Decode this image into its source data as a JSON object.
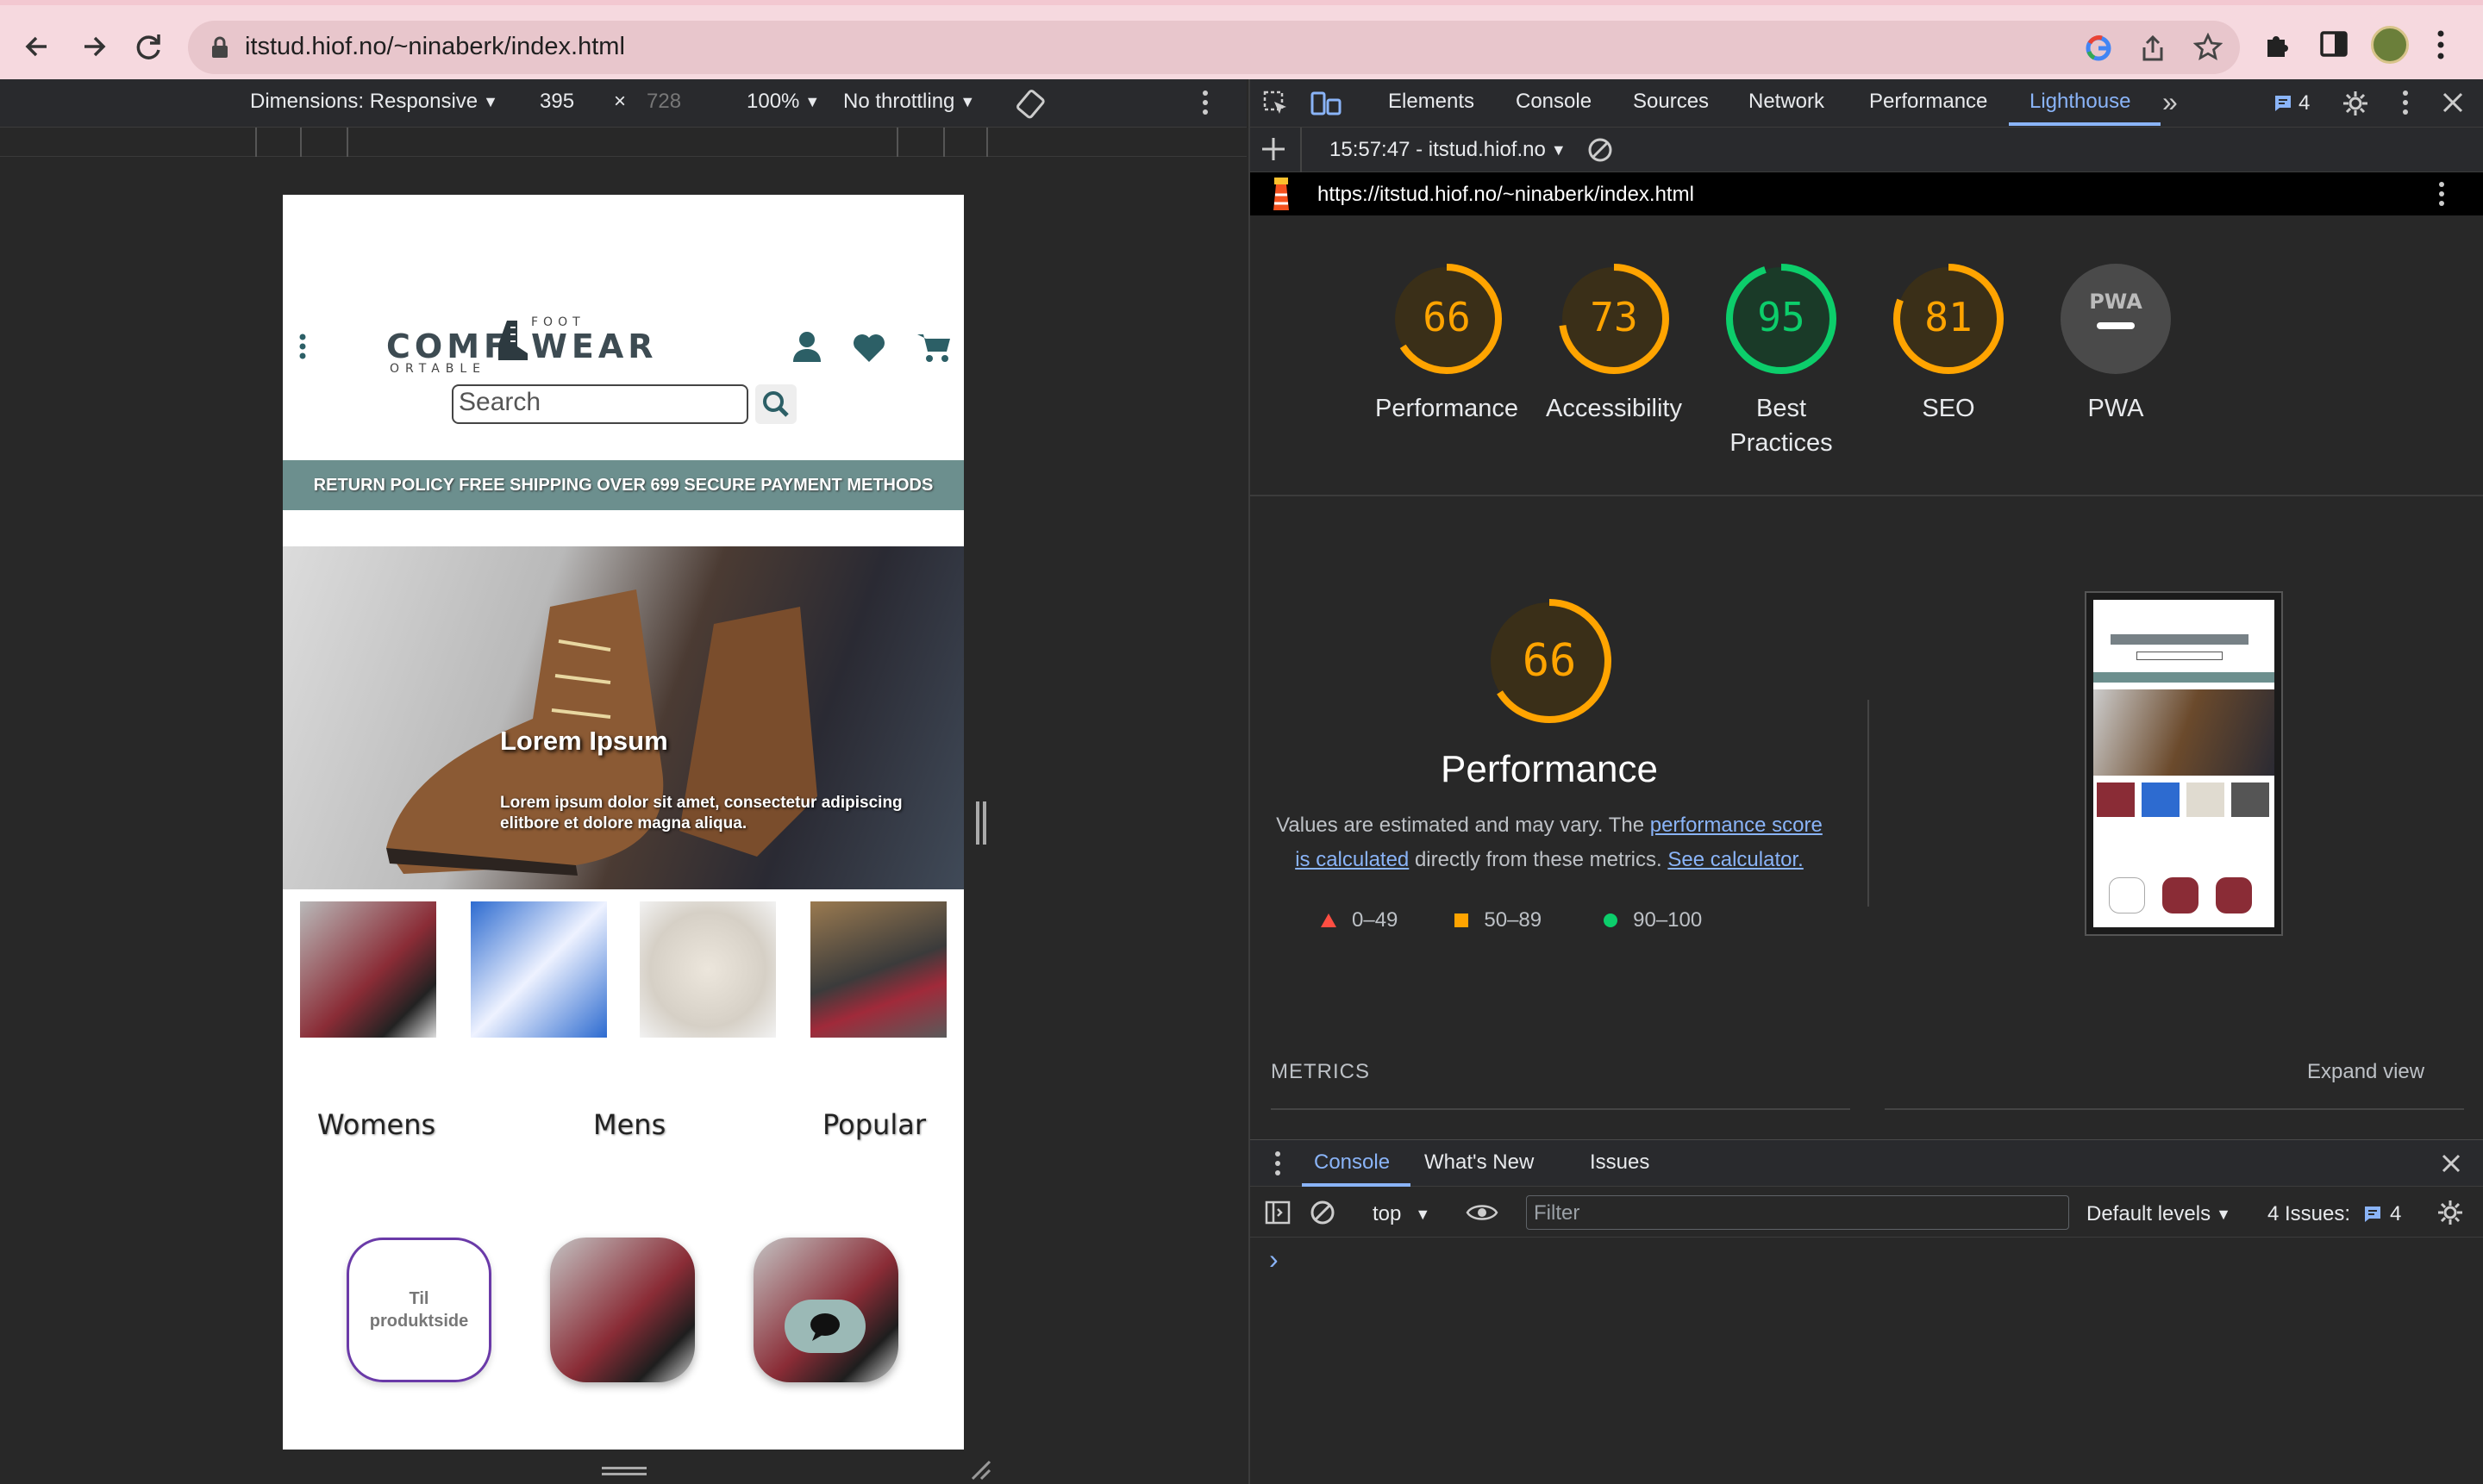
{
  "browser": {
    "url": "itstud.hiof.no/~ninaberk/index.html"
  },
  "device_toolbar": {
    "dimensions": "Dimensions: Responsive",
    "width": "395",
    "times": "×",
    "height": "728",
    "zoom": "100%",
    "throttling": "No throttling"
  },
  "site": {
    "logo": {
      "top": "FOOT",
      "left": "COMF",
      "right": "WEAR",
      "bottom": "ORTABLE"
    },
    "search_placeholder": "Search",
    "banner": "RETURN POLICY FREE SHIPPING OVER 699 SECURE PAYMENT METHODS",
    "hero_title": "Lorem Ipsum",
    "hero_text": "Lorem ipsum dolor sit amet, consectetur adipiscing elitbore et dolore magna aliqua.",
    "categories": [
      "Womens",
      "Mens",
      "Popular"
    ],
    "cta": "Til produktside"
  },
  "devtools": {
    "tabs": [
      "Elements",
      "Console",
      "Sources",
      "Network",
      "Performance",
      "Lighthouse"
    ],
    "active_tab": "Lighthouse",
    "issues_count": "4",
    "report_select": "15:57:47 - itstud.hiof.no",
    "report_url": "https://itstud.hiof.no/~ninaberk/index.html",
    "gauges": [
      {
        "score": "66",
        "label": "Performance",
        "color": "#ffa400"
      },
      {
        "score": "73",
        "label": "Accessibility",
        "color": "#ffa400"
      },
      {
        "score": "95",
        "label": "Best Practices",
        "color": "#0cce6b"
      },
      {
        "score": "81",
        "label": "SEO",
        "color": "#ffa400"
      },
      {
        "score": "PWA",
        "label": "PWA",
        "color": "#9aa0a6"
      }
    ],
    "big_score": "66",
    "big_title": "Performance",
    "desc_prefix": "Values are estimated and may vary. The ",
    "link1": "performance score is calculated",
    "desc_mid": " directly from these metrics. ",
    "link2": "See calculator.",
    "legend": [
      "0–49",
      "50–89",
      "90–100"
    ],
    "metrics_label": "METRICS",
    "expand_view": "Expand view",
    "console": {
      "tabs": [
        "Console",
        "What's New",
        "Issues"
      ],
      "context": "top",
      "filter_placeholder": "Filter",
      "levels": "Default levels",
      "issues_label": "4 Issues:",
      "issues_count": "4",
      "prompt": "›"
    }
  }
}
